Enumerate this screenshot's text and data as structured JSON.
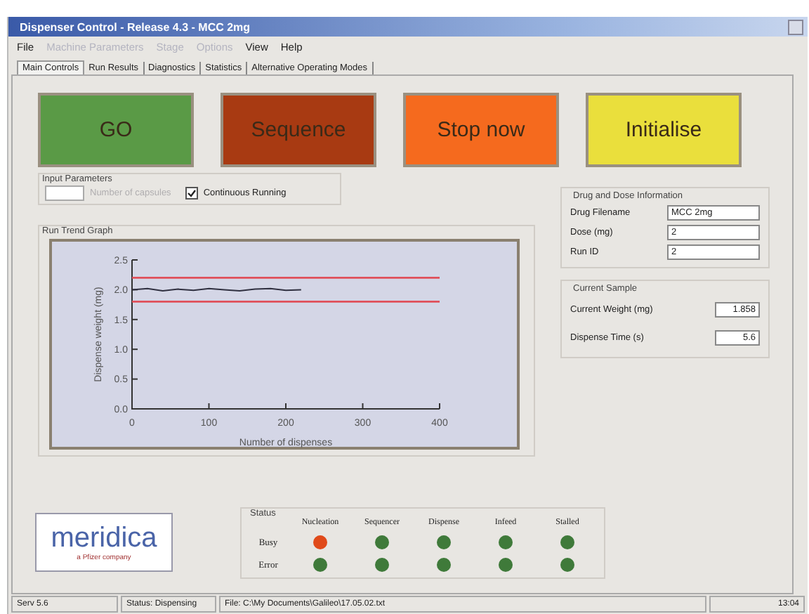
{
  "window": {
    "title": "Dispenser Control - Release 4.3 - MCC 2mg"
  },
  "menu": [
    {
      "label": "File",
      "disabled": false
    },
    {
      "label": "Machine Parameters",
      "disabled": true
    },
    {
      "label": "Stage",
      "disabled": true
    },
    {
      "label": "Options",
      "disabled": true
    },
    {
      "label": "View",
      "disabled": false
    },
    {
      "label": "Help",
      "disabled": false
    }
  ],
  "tabs": [
    {
      "label": "Main Controls",
      "selected": true
    },
    {
      "label": "Run Results",
      "selected": false
    },
    {
      "label": "Diagnostics",
      "selected": false
    },
    {
      "label": "Statistics",
      "selected": false
    },
    {
      "label": "Alternative Operating Modes",
      "selected": false
    }
  ],
  "action_buttons": [
    {
      "label": "GO",
      "color": "#5a9a46"
    },
    {
      "label": "Sequence",
      "color": "#a83a12"
    },
    {
      "label": "Stop now",
      "color": "#f56a1e"
    },
    {
      "label": "Initialise",
      "color": "#eadf3c"
    }
  ],
  "input_parameters": {
    "title": "Input Parameters",
    "count_label": "Number of capsules",
    "count_disabled": true,
    "continuous": {
      "label": "Continuous Running",
      "checked": true
    }
  },
  "graph": {
    "title": "Run Trend Graph",
    "chart_data": {
      "type": "line",
      "xlabel": "Number of dispenses",
      "ylabel": "Dispense weight (mg)",
      "x": [
        0,
        20,
        40,
        60,
        80,
        100,
        120,
        140,
        160,
        180,
        200,
        220,
        240,
        260,
        280,
        300,
        320,
        340,
        360,
        380,
        400
      ],
      "xlim": [
        0,
        400
      ],
      "ylim": [
        0,
        2.5
      ],
      "xticks": [
        0,
        100,
        200,
        300,
        400
      ],
      "yticks": [
        {
          "value": 0,
          "label": "0.0"
        },
        {
          "value": 0.5,
          "label": "0.5"
        },
        {
          "value": 1,
          "label": "1.0"
        },
        {
          "value": 1.5,
          "label": "1.5"
        },
        {
          "value": 2,
          "label": "2.0"
        },
        {
          "value": 2.5,
          "label": "2.5"
        }
      ],
      "series": [
        {
          "color": "#e0505a",
          "values": [
            2.2,
            2.2,
            2.2,
            2.2,
            2.2,
            2.2,
            2.2,
            2.2,
            2.2,
            2.2,
            2.2,
            2.2,
            2.2,
            2.2,
            2.2,
            2.2,
            2.2,
            2.2,
            2.2,
            2.2,
            2.2
          ]
        },
        {
          "color": "#e0505a",
          "values": [
            1.8,
            1.8,
            1.8,
            1.8,
            1.8,
            1.8,
            1.8,
            1.8,
            1.8,
            1.8,
            1.8,
            1.8,
            1.8,
            1.8,
            1.8,
            1.8,
            1.8,
            1.8,
            1.8,
            1.8,
            1.8
          ]
        },
        {
          "color": "#303040",
          "values": [
            2.0,
            2.02,
            1.98,
            2.01,
            1.99,
            2.02,
            2.0,
            1.98,
            2.01,
            2.02,
            1.99,
            2.0,
            null,
            null,
            null,
            null,
            null,
            null,
            null,
            null,
            null
          ]
        }
      ]
    }
  },
  "drug_info": {
    "title": "Drug and Dose Information",
    "fields": [
      {
        "label": "Drug Filename",
        "value": "MCC 2mg"
      },
      {
        "label": "Dose (mg)",
        "value": "2"
      },
      {
        "label": "Run ID",
        "value": "2"
      }
    ]
  },
  "current_sample": {
    "title": "Current Sample",
    "fields": [
      {
        "label": "Current Weight (mg)",
        "value": "1.858"
      },
      {
        "label": "Dispense Time (s)",
        "value": "5.6"
      }
    ]
  },
  "logo": {
    "name": "meridica",
    "tagline": "a Pfizer company"
  },
  "status": {
    "title": "Status",
    "columns": [
      "Nucleation",
      "Sequencer",
      "Dispense",
      "Infeed",
      "Stalled"
    ],
    "rows": [
      {
        "label": "Busy",
        "lights": [
          {
            "color": "#e04a1a"
          },
          {
            "color": "#3f7a3a"
          },
          {
            "color": "#3f7a3a"
          },
          {
            "color": "#3f7a3a"
          },
          {
            "color": "#3f7a3a"
          }
        ]
      },
      {
        "label": "Error",
        "lights": [
          {
            "color": "#3f7a3a"
          },
          {
            "color": "#3f7a3a"
          },
          {
            "color": "#3f7a3a"
          },
          {
            "color": "#3f7a3a"
          },
          {
            "color": "#3f7a3a"
          }
        ]
      }
    ]
  },
  "status_bar": [
    "Serv 5.6",
    "Status: Dispensing",
    "File: C:\\My Documents\\Galileo\\17.05.02.txt",
    "13:04"
  ]
}
